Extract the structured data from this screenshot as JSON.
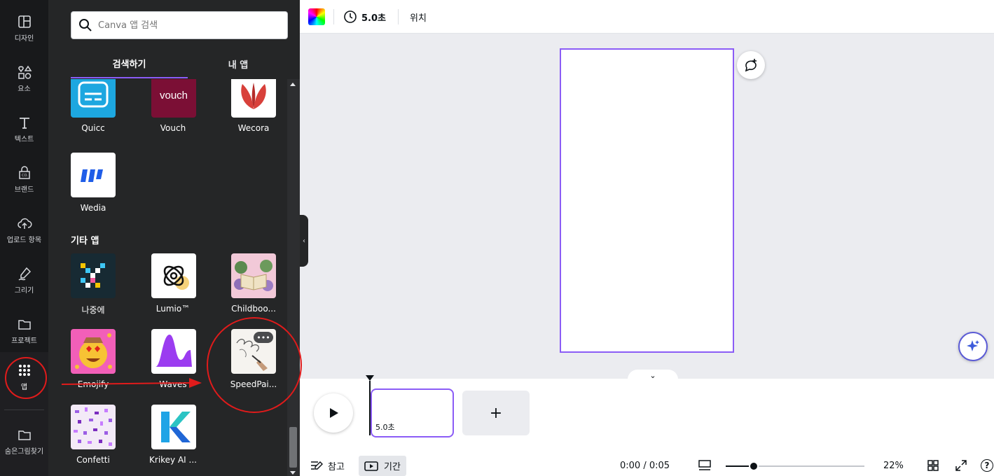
{
  "rail": {
    "items": [
      {
        "label": "디자인",
        "icon": "layout-icon"
      },
      {
        "label": "요소",
        "icon": "shapes-icon"
      },
      {
        "label": "텍스트",
        "icon": "text-icon"
      },
      {
        "label": "브랜드",
        "icon": "brand-icon"
      },
      {
        "label": "업로드 항목",
        "icon": "upload-cloud-icon"
      },
      {
        "label": "그리기",
        "icon": "draw-icon"
      },
      {
        "label": "프로젝트",
        "icon": "folder-icon"
      },
      {
        "label": "앱",
        "icon": "apps-grid-icon"
      },
      {
        "label": "숨은그림찾기",
        "icon": "folder-icon"
      }
    ]
  },
  "panel": {
    "search_placeholder": "Canva 앱 검색",
    "tabs": {
      "browse": "검색하기",
      "mine": "내 앱"
    },
    "section_other": "기타 앱",
    "apps_top": [
      {
        "name": "Quicc",
        "icon": "quicc-icon"
      },
      {
        "name": "Vouch",
        "icon": "vouch-icon",
        "tile_text": "vouch"
      },
      {
        "name": "Wecora",
        "icon": "wecora-icon"
      },
      {
        "name": "Wedia",
        "icon": "wedia-icon"
      }
    ],
    "apps_other": [
      {
        "name": "나중에",
        "icon": "later-icon"
      },
      {
        "name": "Lumio™",
        "icon": "lumio-icon"
      },
      {
        "name": "Childboo...",
        "icon": "childbook-icon"
      },
      {
        "name": "Emojify",
        "icon": "emojify-icon"
      },
      {
        "name": "Waves",
        "icon": "waves-icon"
      },
      {
        "name": "SpeedPai...",
        "icon": "speedpaint-icon"
      },
      {
        "name": "Confetti",
        "icon": "confetti-icon"
      },
      {
        "name": "Krikey AI ...",
        "icon": "krikey-icon"
      }
    ]
  },
  "toolbar": {
    "duration": "5.0초",
    "position": "위치"
  },
  "timeline": {
    "clip_duration": "5.0초",
    "time_display": "0:00 / 0:05",
    "notes_label": "참고",
    "duration_label": "기간",
    "zoom": "22%",
    "zoom_fraction": 0.2
  },
  "colors": {
    "accent": "#8b5cf6",
    "rail_bg": "#18191b",
    "panel_bg": "#252627",
    "annotation": "#e01b1b"
  }
}
